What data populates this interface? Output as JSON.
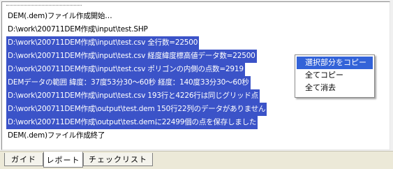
{
  "log": {
    "lines": [
      {
        "text": "DEM(.dem)ファイル作成開始…",
        "selected": false
      },
      {
        "text": "D:\\work\\200711DEM作成\\input\\test.SHP",
        "selected": false
      },
      {
        "text": "D:\\work\\200711DEM作成\\input\\test.csv 全行数=22500",
        "selected": true
      },
      {
        "text": "D:\\work\\200711DEM作成\\input\\test.csv 経度緯度標高値データ数=22500",
        "selected": true
      },
      {
        "text": "D:\\work\\200711DEM作成\\input\\test.csv ポリゴンの内側の点数=2919",
        "selected": true
      },
      {
        "text": "DEMデータの範囲 緯度：37度53分30～60秒 経度：140度33分30～60秒",
        "selected": true
      },
      {
        "text": "D:\\work\\200711DEM作成\\input\\test.csv 193行と4226行は同じグリッド点",
        "selected": true
      },
      {
        "text": "D:\\work\\200711DEM作成\\output\\test.dem 150行22列のデータがありません",
        "selected": true
      },
      {
        "text": "D:\\work\\200711DEM作成\\output\\test.demに22499個の点を保存しました",
        "selected": true
      },
      {
        "text": "DEM(.dem)ファイル作成終了",
        "selected": false
      }
    ]
  },
  "context_menu": {
    "items": [
      {
        "label": "選択部分をコピー",
        "highlighted": true
      },
      {
        "label": "全てコピー",
        "highlighted": false
      },
      {
        "label": "全て消去",
        "highlighted": false
      }
    ]
  },
  "tabs": [
    {
      "label": "ガイド",
      "selected": false
    },
    {
      "label": "レポート",
      "selected": true
    },
    {
      "label": "チェックリスト",
      "selected": false
    }
  ],
  "colors": {
    "selection": "#3b53c8",
    "menu_highlight": "#3363d8"
  }
}
